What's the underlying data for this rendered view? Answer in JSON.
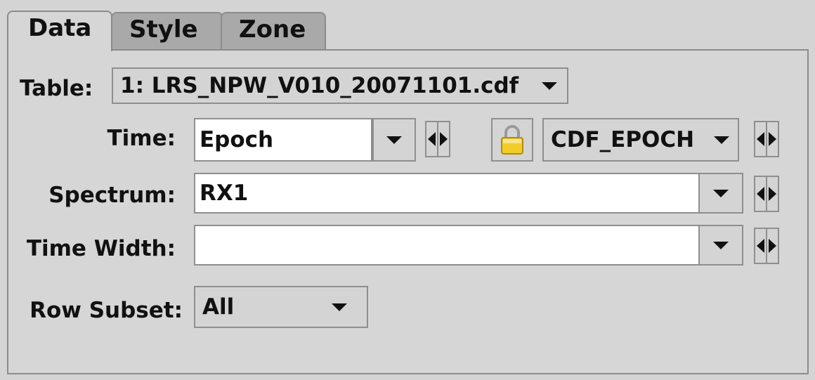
{
  "tabs": [
    {
      "label": "Data"
    },
    {
      "label": "Style"
    },
    {
      "label": "Zone"
    }
  ],
  "table": {
    "label": "Table:",
    "value": "1: LRS_NPW_V010_20071101.cdf"
  },
  "time": {
    "label": "Time:",
    "value": "Epoch",
    "unit": "CDF_EPOCH"
  },
  "spectrum": {
    "label": "Spectrum:",
    "value": "RX1"
  },
  "time_width": {
    "label": "Time Width:",
    "value": ""
  },
  "row_subset": {
    "label": "Row Subset:",
    "value": "All"
  },
  "icons": {
    "lock": "lock-icon",
    "dropdown": "chevron-down-icon"
  },
  "colors": {
    "panel": "#d6d6d6",
    "lock_body": "#f2cc2a"
  }
}
